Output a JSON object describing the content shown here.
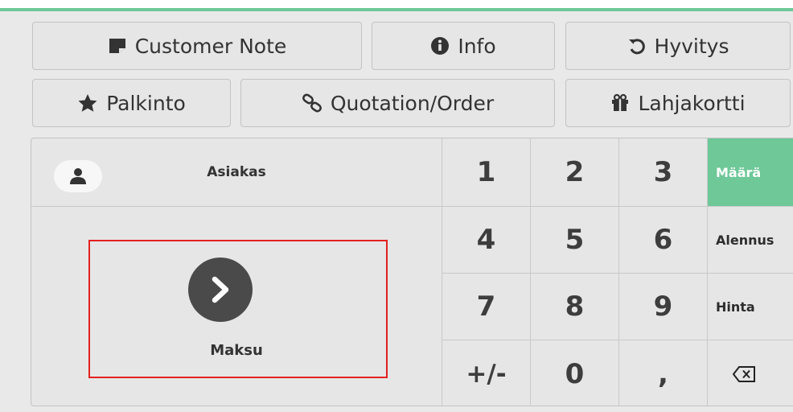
{
  "toolbar": {
    "row1": [
      {
        "label": "Customer Note",
        "icon": "note-icon"
      },
      {
        "label": "Info",
        "icon": "info-icon"
      },
      {
        "label": "Hyvitys",
        "icon": "undo-icon"
      }
    ],
    "row2": [
      {
        "label": "Palkinto",
        "icon": "star-icon"
      },
      {
        "label": "Quotation/Order",
        "icon": "link-icon"
      },
      {
        "label": "Lahjakortti",
        "icon": "gift-icon"
      }
    ]
  },
  "customer": {
    "label": "Asiakas",
    "icon": "user-icon"
  },
  "payment": {
    "label": "Maksu",
    "icon": "chevron-right-icon"
  },
  "numpad": {
    "keys": [
      "1",
      "2",
      "3",
      "4",
      "5",
      "6",
      "7",
      "8",
      "9",
      "+/-",
      "0",
      ","
    ]
  },
  "modes": {
    "quantity": "Määrä",
    "discount": "Alennus",
    "price": "Hinta",
    "backspace_icon": "backspace-icon",
    "active_color": "#6ec898"
  },
  "colors": {
    "accent": "#6ec898",
    "highlight": "#e32020"
  }
}
